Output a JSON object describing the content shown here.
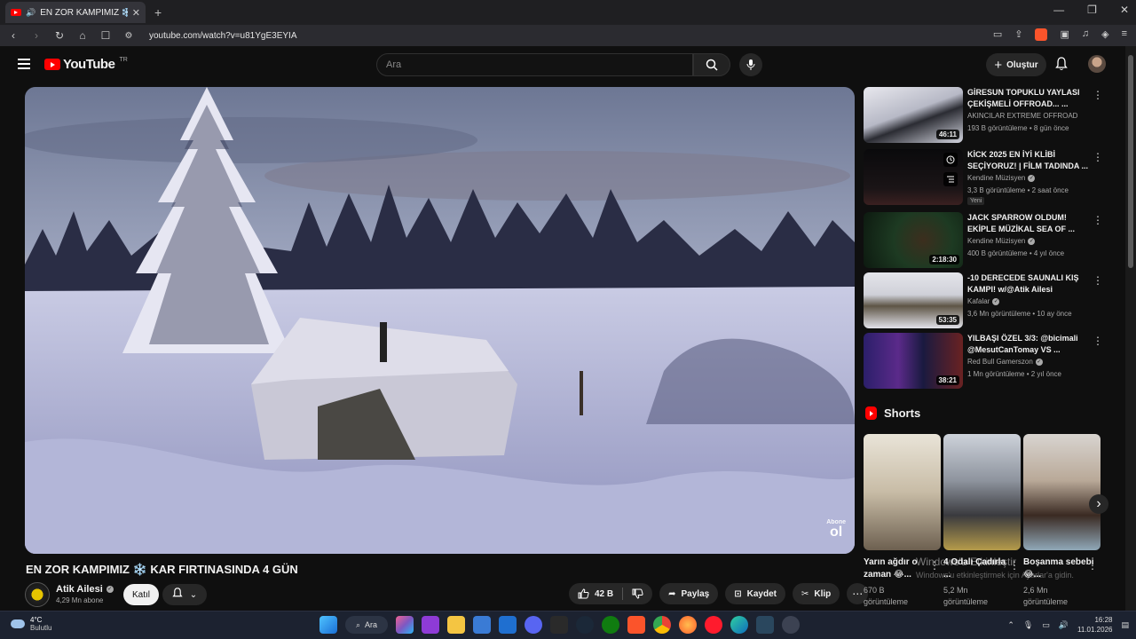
{
  "browser": {
    "tab_title": "EN ZOR KAMPIMIZ ❄️ KAR F",
    "url": "youtube.com/watch?v=u81YgE3EYIA"
  },
  "header": {
    "logo_text": "YouTube",
    "region": "TR",
    "search_placeholder": "Ara",
    "create_label": "Oluştur"
  },
  "video": {
    "title": "EN ZOR KAMPIMIZ ❄️ KAR FIRTINASINDA 4 GÜN",
    "watermark_small": "Abone",
    "watermark_big": "ol",
    "channel": "Atik Ailesi",
    "subscribers": "4,29 Mn abone",
    "join_label": "Katıl",
    "likes": "42 B",
    "share_label": "Paylaş",
    "save_label": "Kaydet",
    "clip_label": "Klip",
    "more_label": "⋯"
  },
  "recommendations": [
    {
      "title": "GİRESUN TOPUKLU YAYLASI ÇEKİŞMELİ OFFROAD... ...",
      "channel": "AKINCILAR EXTREME OFFROAD",
      "meta": "193 B görüntüleme • 8 gün önce",
      "duration": "46:11",
      "verified": false,
      "badge": ""
    },
    {
      "title": "KİCK 2025 EN İYİ KLİBİ SEÇİYORUZ! | FİLM TADINDA ...",
      "channel": "Kendine Müzisyen",
      "meta": "3,3 B görüntüleme • 2 saat önce",
      "duration": "",
      "verified": true,
      "badge": "Yeni"
    },
    {
      "title": "JACK SPARROW OLDUM! EKİPLE MÜZİKAL SEA OF ...",
      "channel": "Kendine Müzisyen",
      "meta": "400 B görüntüleme • 4 yıl önce",
      "duration": "2:18:30",
      "verified": true,
      "badge": ""
    },
    {
      "title": "-10 DERECEDE SAUNALI KIŞ KAMPI! w/@Atik Ailesi",
      "channel": "Kafalar",
      "meta": "3,6 Mn görüntüleme • 10 ay önce",
      "duration": "53:35",
      "verified": true,
      "badge": ""
    },
    {
      "title": "YILBAŞI ÖZEL 3/3: @bicimali @MesutCanTomay VS ...",
      "channel": "Red Bull Gamerszon",
      "meta": "1 Mn görüntüleme • 2 yıl önce",
      "duration": "38:21",
      "verified": true,
      "badge": ""
    }
  ],
  "shorts": {
    "heading": "Shorts",
    "items": [
      {
        "title": "Yarın ağdır o zaman 😂...",
        "views_line1": "670 B",
        "views_line2": "görüntüleme"
      },
      {
        "title": "4 Odalı Çadırla ...",
        "views_line1": "5,2 Mn",
        "views_line2": "görüntüleme"
      },
      {
        "title": "Boşanma sebebi 😂...",
        "views_line1": "2,6 Mn",
        "views_line2": "görüntüleme"
      }
    ]
  },
  "windows_overlay": {
    "line1": "Windows'u Etkinleştir",
    "line2": "Windows'u etkinleştirmek için Ayarlar'a gidin."
  },
  "taskbar": {
    "temperature": "4°C",
    "weather": "Bulutlu",
    "search_label": "Ara",
    "time": "16:28",
    "date": "11.01.2026"
  }
}
